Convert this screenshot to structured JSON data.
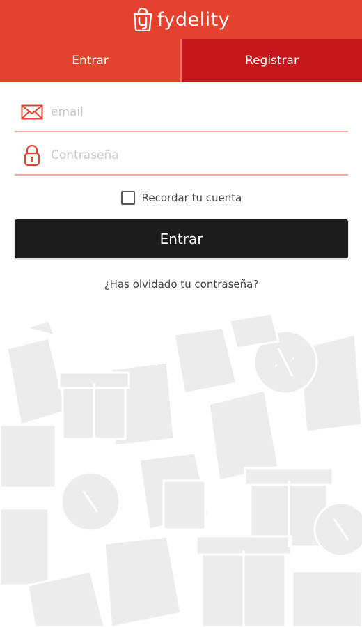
{
  "brand": {
    "name": "fydelity",
    "color": "#e5412f"
  },
  "tabs": [
    {
      "label": "Entrar",
      "active": true,
      "color": "#e5412f"
    },
    {
      "label": "Registrar",
      "active": false,
      "color": "#c8161d"
    }
  ],
  "form": {
    "email": {
      "placeholder": "email",
      "value": "",
      "icon": "envelope-icon"
    },
    "password": {
      "placeholder": "Contraseña",
      "value": "",
      "icon": "lock-icon"
    },
    "remember_label": "Recordar tu cuenta",
    "remember_checked": false,
    "submit_label": "Entrar",
    "forgot_label": "¿Has olvidado tu contraseña?"
  },
  "colors": {
    "accent": "#e5412f",
    "accent_dark": "#c8161d",
    "button": "#1c1c1c",
    "field_underline": "#f2a9a1",
    "decor": "#ececec"
  }
}
